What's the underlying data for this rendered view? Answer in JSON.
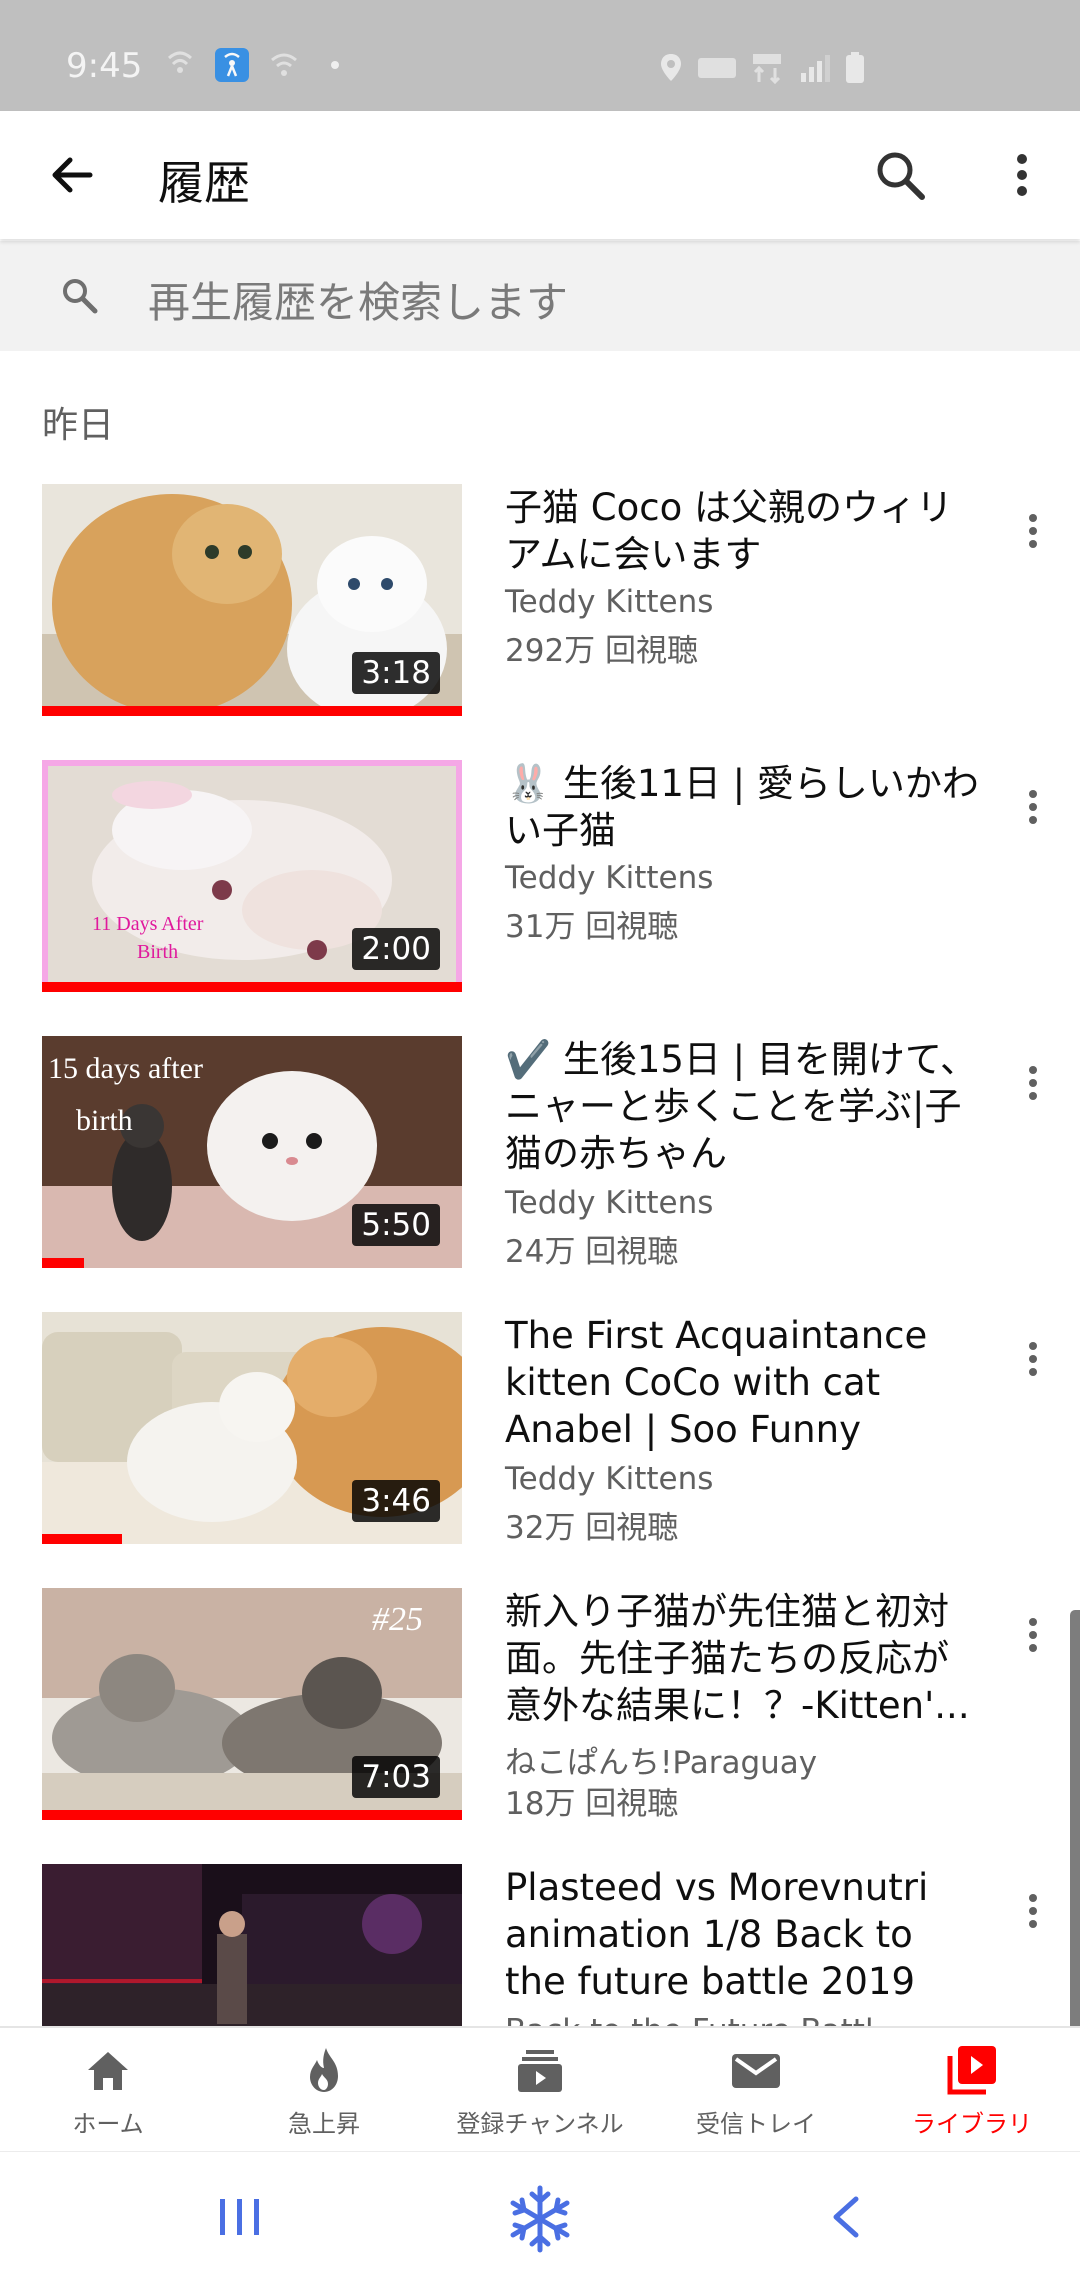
{
  "status_bar": {
    "time": "9:45"
  },
  "app_bar": {
    "title": "履歴",
    "back_icon": "arrow-back-icon",
    "search_icon": "search-icon",
    "more_icon": "more-vert-icon"
  },
  "search": {
    "placeholder": "再生履歴を検索します"
  },
  "section": {
    "label": "昨日"
  },
  "videos": [
    {
      "title": "子猫 Coco は父親のウィリアムに会います",
      "channel": "Teddy Kittens",
      "views": "292万 回視聴",
      "duration": "3:18",
      "progress": 1.0
    },
    {
      "title": "🐰 生後11日 |  愛らしいかわい子猫",
      "channel": "Teddy Kittens",
      "views": "31万 回視聴",
      "duration": "2:00",
      "progress": 1.0,
      "thumb_text": [
        "11 Days After",
        "Birth"
      ]
    },
    {
      "title": "✔️ 生後15日 | 目を開けて、ニャーと歩くことを学ぶ|子猫の赤ちゃん",
      "channel": "Teddy Kittens",
      "views": "24万 回視聴",
      "duration": "5:50",
      "progress": 0.1,
      "thumb_text": [
        "15 days after",
        "birth"
      ]
    },
    {
      "title": "The First Acquaintance kitten CoCo with cat Anabel | Soo Funny",
      "channel": "Teddy Kittens",
      "views": "32万 回視聴",
      "duration": "3:46",
      "progress": 0.19
    },
    {
      "title": "新入り子猫が先住猫と初対面。先住子猫たちの反応が意外な結果に！？-Kitten'...",
      "channel": "ねこぱんち!Paraguay",
      "views": "18万 回視聴",
      "duration": "7:03",
      "progress": 1.0,
      "thumb_text": [
        "#25"
      ]
    },
    {
      "title": "Plasteed vs Morevnutri animation 1/8 Back to the future battle 2019",
      "channel": "Back to the Future Battl",
      "views": "",
      "duration": "",
      "progress": 0
    }
  ],
  "bottom_nav": [
    {
      "label": "ホーム",
      "icon": "home-icon",
      "active": false
    },
    {
      "label": "急上昇",
      "icon": "trending-flame-icon",
      "active": false
    },
    {
      "label": "登録チャンネル",
      "icon": "subscriptions-icon",
      "active": false
    },
    {
      "label": "受信トレイ",
      "icon": "inbox-mail-icon",
      "active": false
    },
    {
      "label": "ライブラリ",
      "icon": "library-icon",
      "active": true
    }
  ],
  "colors": {
    "accent": "#ff0000",
    "text_primary": "#0f0f0f",
    "text_secondary": "#606060",
    "system_nav_blue": "#4a6fe3"
  }
}
